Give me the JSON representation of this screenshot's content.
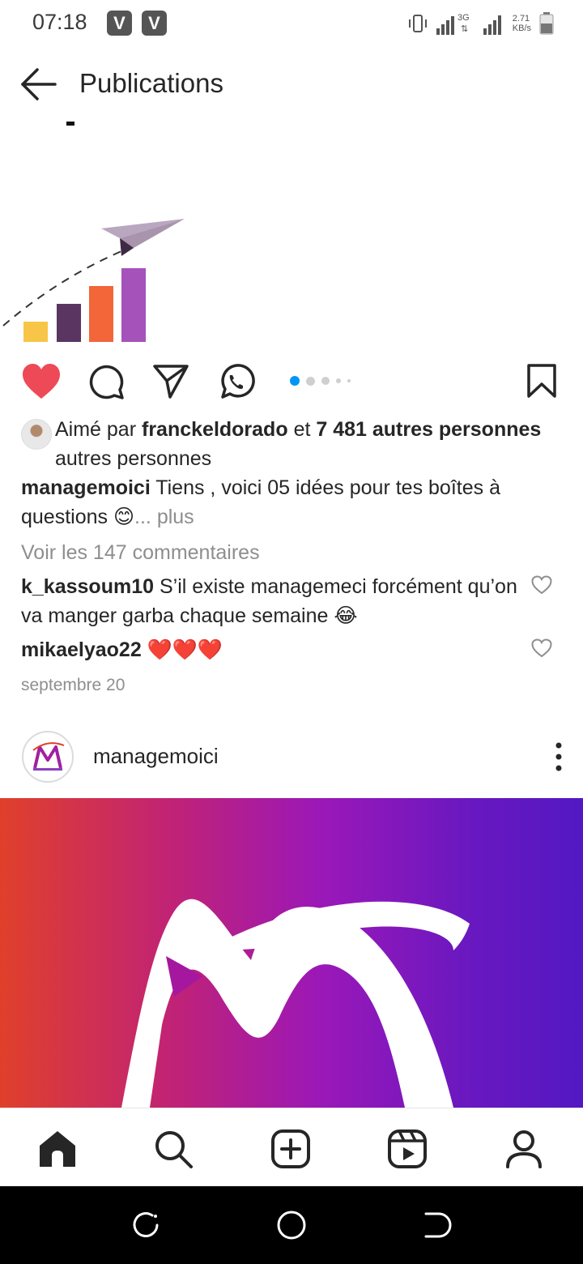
{
  "status_bar": {
    "time": "07:18",
    "badges": [
      "V",
      "V"
    ],
    "network_type": "3G",
    "speed_value": "2.71",
    "speed_unit": "KB/s",
    "icons": [
      "vibrate-icon",
      "signal-icon",
      "signal-icon",
      "battery-icon"
    ]
  },
  "header": {
    "title": "Publications",
    "back_icon": "arrow-left-icon"
  },
  "post1": {
    "actions": {
      "like_icon": "heart-filled-icon",
      "comment_icon": "comment-icon",
      "share_icon": "paper-plane-icon",
      "whatsapp_icon": "whatsapp-icon",
      "save_icon": "bookmark-icon",
      "carousel_count": 4,
      "carousel_active_index": 0
    },
    "liked_by": {
      "prefix": "Aimé par",
      "user": "franckeldorado",
      "connector": "et",
      "others": "7 481 autres personnes",
      "suffix": "autres personnes"
    },
    "caption": {
      "username": "managemoici",
      "text": "Tiens , voici 05 idées pour tes boîtes à questions 😊",
      "more": "... plus"
    },
    "view_comments": "Voir les 147 commentaires",
    "comments": [
      {
        "username": "k_kassoum10",
        "text": "S’il existe managemeci forcément qu’on va manger garba chaque semaine 😂"
      },
      {
        "username": "mikaelyao22",
        "text": "❤️❤️❤️"
      }
    ],
    "date": "septembre 20"
  },
  "post2": {
    "username": "managemoici"
  },
  "bottom_nav": {
    "items": [
      "home-icon",
      "search-icon",
      "add-post-icon",
      "reels-icon",
      "profile-icon"
    ]
  },
  "colors": {
    "like_red": "#ed4956",
    "carousel_active": "#0095f6",
    "banner_start": "#e0402a",
    "banner_end": "#5318c2"
  }
}
